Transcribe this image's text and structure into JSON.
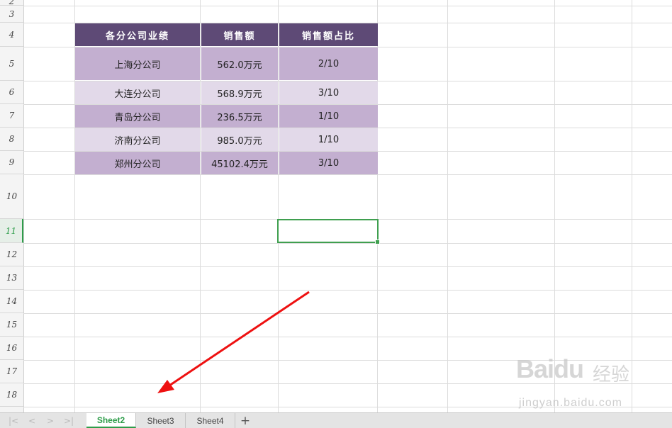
{
  "row_headers": [
    "2",
    "3",
    "4",
    "5",
    "6",
    "7",
    "8",
    "9",
    "10",
    "11",
    "12",
    "13",
    "14",
    "15",
    "16",
    "17",
    "18"
  ],
  "active_row": "11",
  "table": {
    "headers": [
      "各分公司业绩",
      "销售额",
      "销售额占比"
    ],
    "rows": [
      [
        "上海分公司",
        "562.0万元",
        "2/10"
      ],
      [
        "大连分公司",
        "568.9万元",
        "3/10"
      ],
      [
        "青岛分公司",
        "236.5万元",
        "1/10"
      ],
      [
        "济南分公司",
        "985.0万元",
        "1/10"
      ],
      [
        "郑州分公司",
        "45102.4万元",
        "3/10"
      ]
    ]
  },
  "colors": {
    "header_bg": "#5e4a76",
    "row_dark": "#c3afd0",
    "row_light": "#e2d9e9",
    "accent": "#2e9d4a",
    "annotation_arrow": "#ee1111"
  },
  "sheet_tabs": [
    "Sheet2",
    "Sheet3",
    "Sheet4"
  ],
  "active_tab": "Sheet2",
  "add_sheet_label": "+",
  "nav_buttons": [
    "|<",
    "<",
    ">",
    ">|"
  ],
  "watermark": {
    "logo": "Baidu",
    "cn": "经验",
    "url": "jingyan.baidu.com"
  }
}
